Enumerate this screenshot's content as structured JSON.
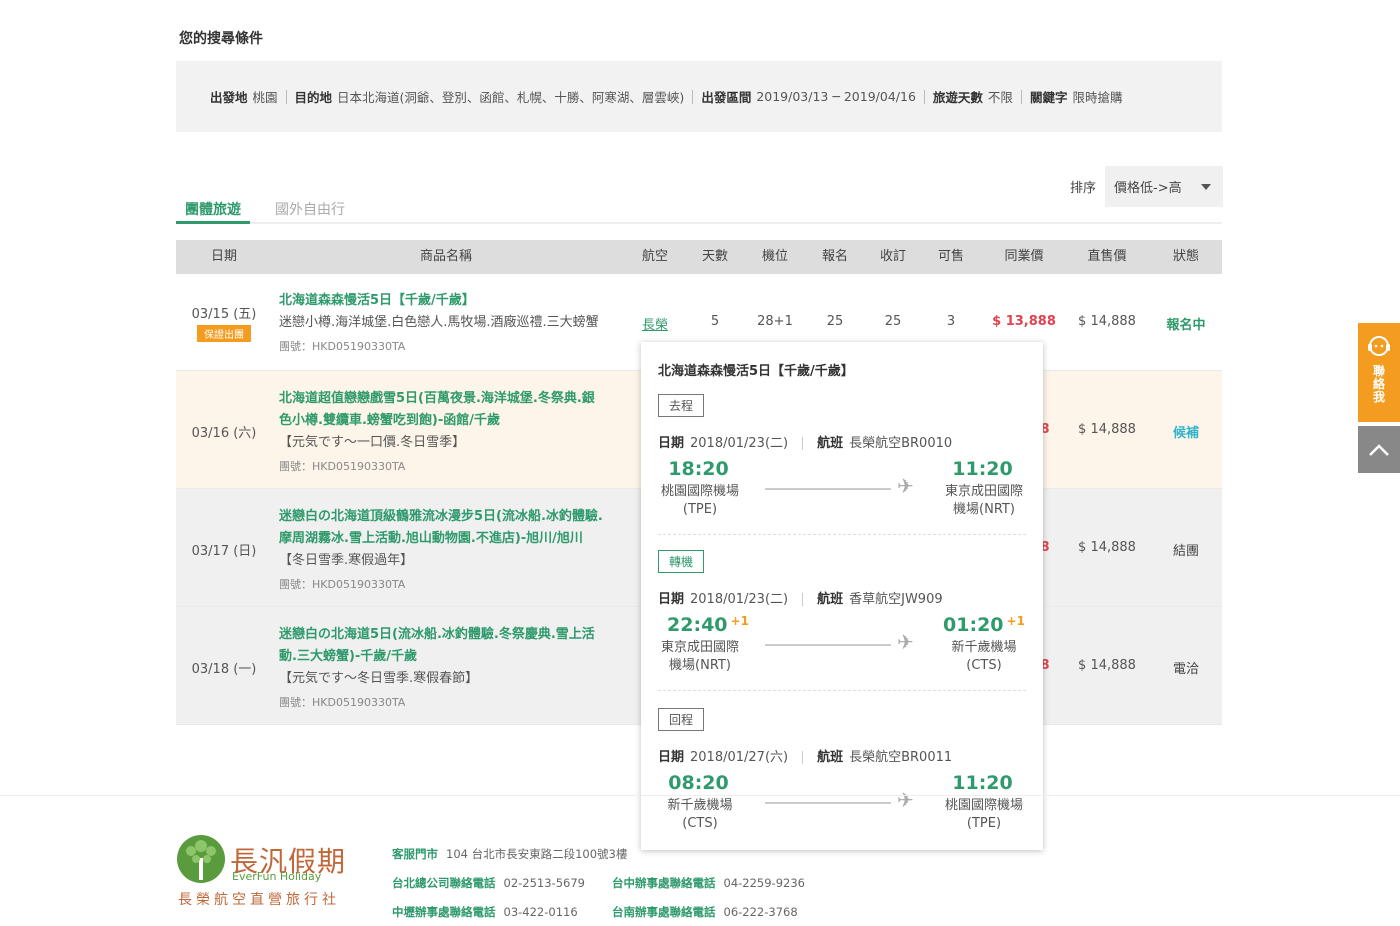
{
  "search": {
    "title": "您的搜尋條件",
    "criteria": [
      {
        "label": "出發地",
        "value": "桃園"
      },
      {
        "label": "目的地",
        "value": "日本北海道(洞爺、登別、函館、札幌、十勝、阿寒湖、層雲峽)"
      },
      {
        "label": "出發區間",
        "value": "2019/03/13 ─ 2019/04/16"
      },
      {
        "label": "旅遊天數",
        "value": "不限"
      },
      {
        "label": "關鍵字",
        "value": "限時搶購"
      }
    ]
  },
  "sort": {
    "label": "排序",
    "value": "價格低->高"
  },
  "tabs": [
    {
      "label": "團體旅遊",
      "active": true
    },
    {
      "label": "國外自由行",
      "active": false
    }
  ],
  "table": {
    "headers": [
      "日期",
      "商品名稱",
      "航空",
      "天數",
      "機位",
      "報名",
      "收訂",
      "可售",
      "同業價",
      "直售價",
      "狀態"
    ],
    "rows": [
      {
        "date": "03/15 (五)",
        "badge": "保證出團",
        "name": "北海道森森慢活5日【千歲/千歲】",
        "sub": "迷戀小樽.海洋城堡.白色戀人.馬牧場.酒廠巡禮.三大螃蟹",
        "code": "團號：HKD05190330TA",
        "airline": "長榮",
        "days": "5",
        "seats": "28+1",
        "signed": "25",
        "booked": "25",
        "available": "3",
        "agent_price": "$ 13,888",
        "retail_price": "$ 14,888",
        "status": "報名中"
      },
      {
        "date": "03/16 (六)",
        "name_lines": [
          "北海道超值戀戀戲雪5日(百萬夜景.海洋城堡.冬祭典.銀",
          "色小樽.雙纜車.螃蟹吃到飽)-函館/千歲"
        ],
        "sub": "【元気です～一口價.冬日雪季】",
        "code": "團號：HKD05190330TA",
        "agent_price_partial": "8",
        "retail_price": "$ 14,888",
        "status": "候補"
      },
      {
        "date": "03/17 (日)",
        "name_lines": [
          "迷戀白の北海道頂級鶴雅流冰漫步5日(流冰船.冰釣體驗.",
          "摩周湖霧冰.雪上活動.旭山動物園.不進店)-旭川/旭川"
        ],
        "sub": "【冬日雪季.寒假過年】",
        "code": "團號：HKD05190330TA",
        "agent_price_partial": "8",
        "retail_price": "$ 14,888",
        "status": "結團"
      },
      {
        "date": "03/18 (一)",
        "name_lines": [
          "迷戀白の北海道5日(流冰船.冰釣體驗.冬祭慶典.雪上活",
          "動.三大螃蟹)-千歲/千歲"
        ],
        "sub": "【元気です～冬日雪季.寒假春節】",
        "code": "團號：HKD05190330TA",
        "agent_price_partial": "8",
        "retail_price": "$ 14,888",
        "status": "電洽"
      }
    ]
  },
  "flight_popup": {
    "title": "北海道森森慢活5日【千歲/千歲】",
    "date_label": "日期",
    "flight_label": "航班",
    "segments": [
      {
        "tag": "去程",
        "date": "2018/01/23(二)",
        "flight": "長榮航空BR0010",
        "dep_time": "18:20",
        "dep_plus": "",
        "dep_airport": [
          "桃園國際機場",
          "(TPE)"
        ],
        "arr_time": "11:20",
        "arr_plus": "",
        "arr_airport": [
          "東京成田國際",
          "機場(NRT)"
        ]
      },
      {
        "tag": "轉機",
        "date": "2018/01/23(二)",
        "flight": "香草航空JW909",
        "dep_time": "22:40",
        "dep_plus": "+1",
        "dep_airport": [
          "東京成田國際",
          "機場(NRT)"
        ],
        "arr_time": "01:20",
        "arr_plus": "+1",
        "arr_airport": [
          "新千歲機場",
          "(CTS)"
        ]
      },
      {
        "tag": "回程",
        "date": "2018/01/27(六)",
        "flight": "長榮航空BR0011",
        "dep_time": "08:20",
        "dep_plus": "",
        "dep_airport": [
          "新千歲機場",
          "(CTS)"
        ],
        "arr_time": "11:20",
        "arr_plus": "",
        "arr_airport": [
          "桃園國際機場",
          "(TPE)"
        ]
      }
    ]
  },
  "side": {
    "contact_label": "聯絡我",
    "contact_icon": "headset-icon",
    "top_icon": "chevron-up-icon"
  },
  "footer": {
    "logo_cn": "長汎假期",
    "logo_en": "EverFun Holiday",
    "logo_sub": "長榮航空直營旅行社",
    "service_label": "客服門市",
    "service_value": "104 台北市長安東路二段100號3樓",
    "contacts": [
      {
        "label": "台北總公司聯絡電話",
        "value": "02-2513-5679"
      },
      {
        "label": "台中辦事處聯絡電話",
        "value": "04-2259-9236"
      },
      {
        "label": "中壢辦事處聯絡電話",
        "value": "03-422-0116"
      },
      {
        "label": "台南辦事處聯絡電話",
        "value": "06-222-3768"
      }
    ]
  },
  "colors": {
    "brand_green": "#2f9a6c",
    "accent_orange": "#f39c1f",
    "price_red": "#e0434f",
    "status_cyan": "#35b3c9"
  }
}
